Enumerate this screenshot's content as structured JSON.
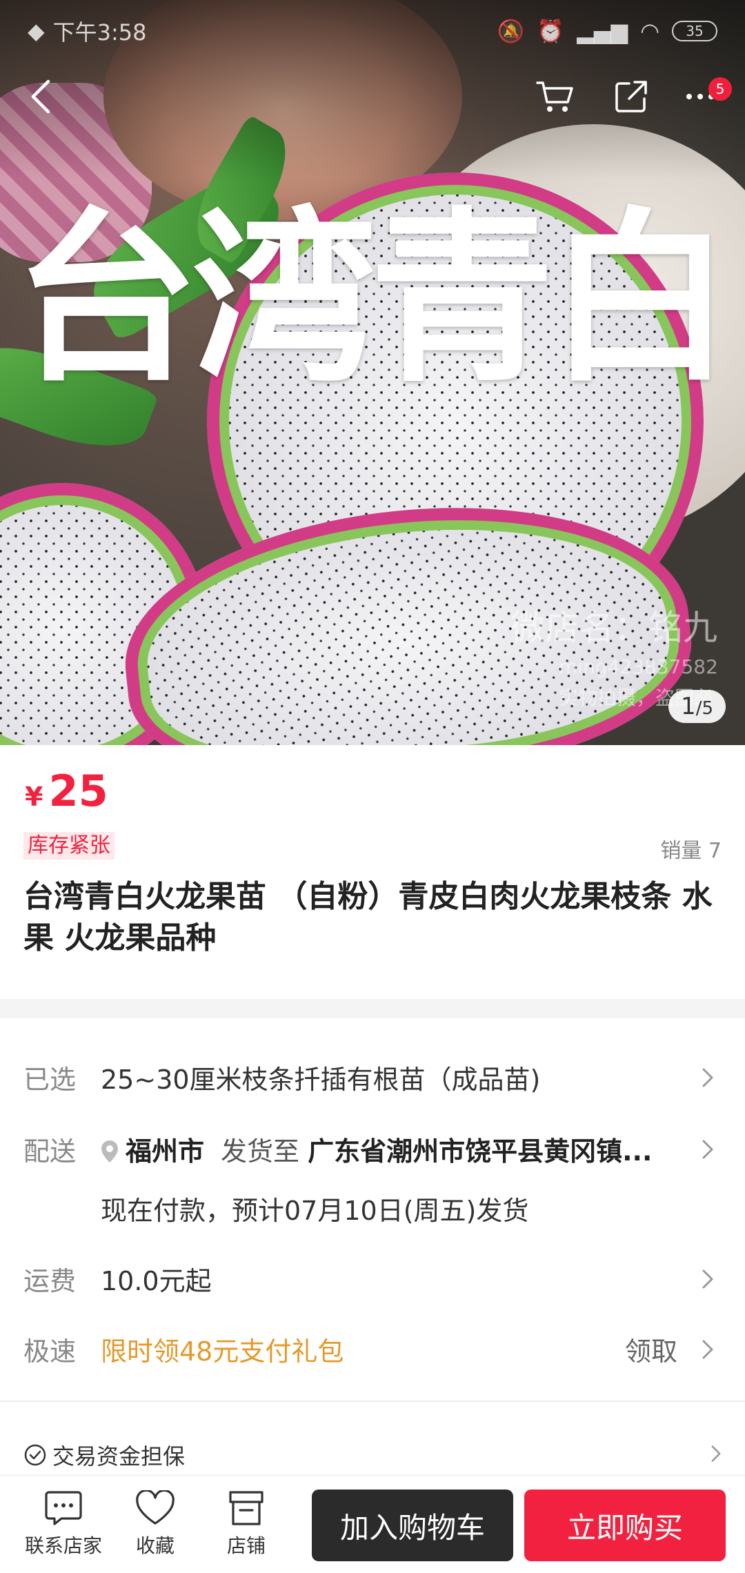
{
  "status_bar": {
    "time": "下午3:58",
    "battery": "35"
  },
  "nav": {
    "more_badge": "5"
  },
  "gallery": {
    "overlay_text": "台湾青白",
    "watermark_line1": "微店名：铭九",
    "watermark_line2": "ming423837582",
    "watermark_line3": "实物拍摄，盗图必",
    "current_page": "1",
    "total_pages": "/5"
  },
  "product": {
    "currency": "¥",
    "price": "25",
    "stock_tag": "库存紧张",
    "sales": "销量 7",
    "title": "台湾青白火龙果苗 （自粉）青皮白肉火龙果枝条 水果  火龙果品种"
  },
  "selected": {
    "label": "已选",
    "value": "25~30厘米枝条扦插有根苗（成品苗)"
  },
  "delivery": {
    "label": "配送",
    "city": "福州市",
    "ship_to_label": "发货至",
    "address": "广东省潮州市饶平县黄冈镇...",
    "ship_time": "现在付款，预计07月10日(周五)发货"
  },
  "shipping_fee": {
    "label": "运费",
    "value": "10.0元起"
  },
  "express": {
    "label": "极速",
    "value": "限时领48元支付礼包",
    "action": "领取"
  },
  "guarantee": {
    "text": "交易资金担保"
  },
  "bottom_bar": {
    "contact": "联系店家",
    "favorite": "收藏",
    "shop": "店铺",
    "add_to_cart": "加入购物车",
    "buy_now": "立即购买"
  },
  "colors": {
    "accent": "#f2213f",
    "express_orange": "#e39a2b",
    "dark_button": "#2b2b2b"
  },
  "icons": [
    "back-icon",
    "cart-icon",
    "share-icon",
    "more-icon",
    "location-pin-icon",
    "chevron-right-icon",
    "check-circle-icon",
    "chat-icon",
    "heart-icon",
    "shop-icon"
  ]
}
